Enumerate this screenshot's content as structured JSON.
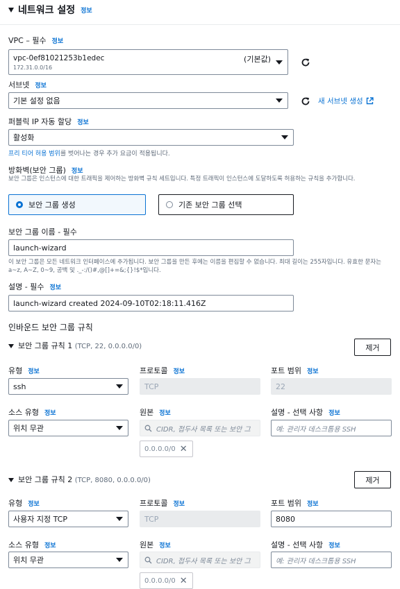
{
  "section": {
    "title": "네트워크 설정",
    "info": "정보"
  },
  "vpc": {
    "label": "VPC – 필수",
    "info": "정보",
    "value": "vpc-0ef81021253b1edec",
    "badge": "(기본값)",
    "cidr": "172.31.0.0/16"
  },
  "subnet": {
    "label": "서브넷",
    "info": "정보",
    "value": "기본 설정 없음",
    "create_link": "새 서브넷 생성"
  },
  "public_ip": {
    "label": "퍼블릭 IP 자동 할당",
    "info": "정보",
    "value": "활성화",
    "help_link": "프리 티어 허용 범위",
    "help_rest": "를 벗어나는 경우 추가 요금이 적용됩니다."
  },
  "firewall": {
    "label": "방화벽(보안 그룹)",
    "info": "정보",
    "help": "보안 그룹은 인스턴스에 대한 트래픽을 제어하는 방화벽 규칙 세트입니다. 특정 트래픽이 인스턴스에 도달하도록 허용하는 규칙을 추가합니다.",
    "option_create": "보안 그룹 생성",
    "option_existing": "기존 보안 그룹 선택"
  },
  "sg_name": {
    "label": "보안 그룹 이름 - 필수",
    "value": "launch-wizard",
    "help": "이 보안 그룹은 모든 네트워크 인터페이스에 추가됩니다. 보안 그룹을 만든 후에는 이름을 편집할 수 없습니다. 최대 길이는 255자입니다. 유효한 문자는 a~z, A~Z, 0~9, 공백 및 ._-:/()#,@[]+=&;{}!$*입니다."
  },
  "description": {
    "label": "설명 - 필수",
    "info": "정보",
    "value": "launch-wizard created 2024-09-10T02:18:11.416Z"
  },
  "inbound": {
    "title": "인바운드 보안 그룹 규칙",
    "remove_label": "제거",
    "labels": {
      "type": "유형",
      "protocol": "프로토콜",
      "port": "포트 범위",
      "source_type": "소스 유형",
      "source": "원본",
      "desc": "설명 - 선택 사항",
      "info": "정보"
    },
    "source_placeholder": "CIDR, 접두사 목록 또는 보안 그",
    "desc_placeholder": "예: 관리자 데스크톱용 SSH",
    "rules": [
      {
        "title": "보안 그룹 규칙 1",
        "summary": "(TCP, 22, 0.0.0.0/0)",
        "type": "ssh",
        "protocol": "TCP",
        "port": "22",
        "source_type": "위치 무관",
        "token": "0.0.0.0/0"
      },
      {
        "title": "보안 그룹 규칙 2",
        "summary": "(TCP, 8080, 0.0.0.0/0)",
        "type": "사용자 지정 TCP",
        "protocol": "TCP",
        "port": "8080",
        "source_type": "위치 무관",
        "token": "0.0.0.0/0"
      }
    ]
  }
}
